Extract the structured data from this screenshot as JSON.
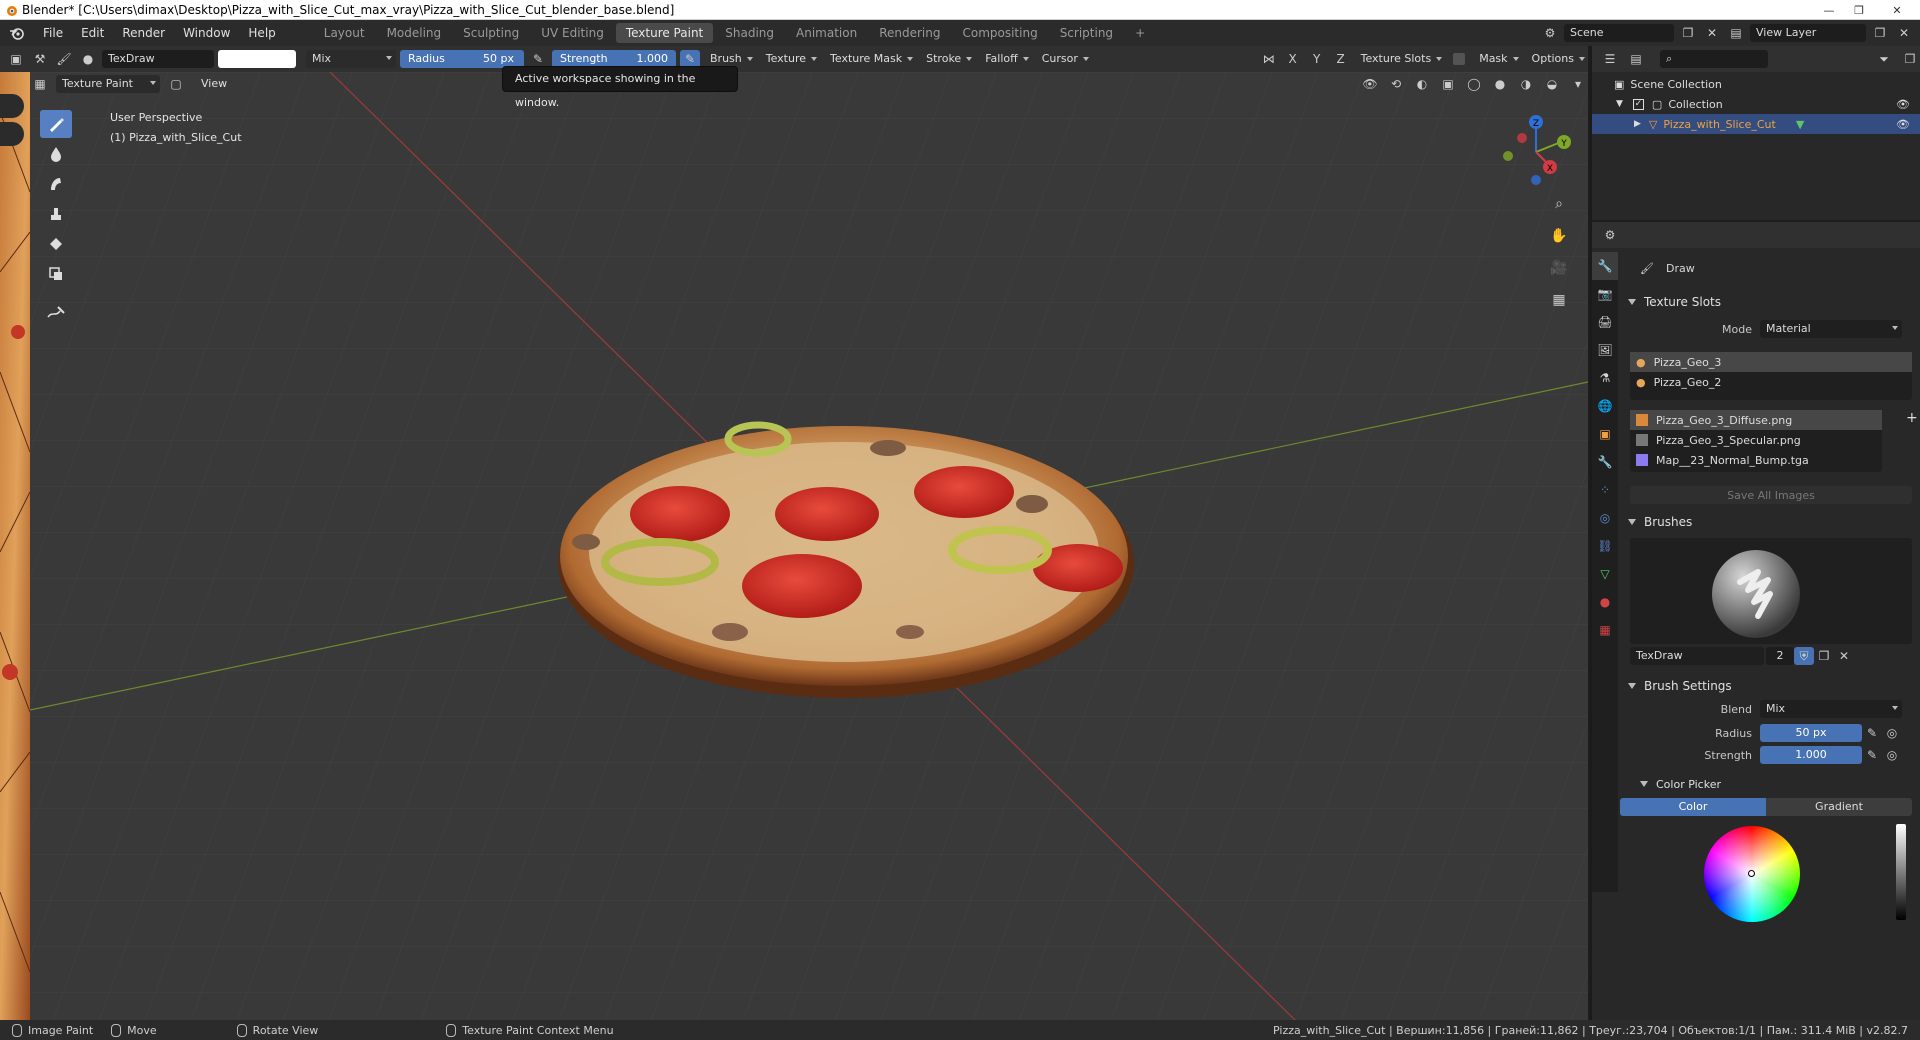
{
  "window": {
    "title": "Blender* [C:\\Users\\dimax\\Desktop\\Pizza_with_Slice_Cut_max_vray\\Pizza_with_Slice_Cut_blender_base.blend]",
    "minimize": "—",
    "maximize": "❐",
    "close": "✕"
  },
  "menubar": {
    "items": [
      "File",
      "Edit",
      "Render",
      "Window",
      "Help"
    ],
    "workspaces": [
      "Layout",
      "Modeling",
      "Sculpting",
      "UV Editing",
      "Texture Paint",
      "Shading",
      "Animation",
      "Rendering",
      "Compositing",
      "Scripting"
    ],
    "active_workspace": "Texture Paint",
    "add_tab": "+",
    "scene": "Scene",
    "view_layer": "View Layer"
  },
  "toolheader": {
    "brush_name": "TexDraw",
    "blend": "Mix",
    "radius_label": "Radius",
    "radius_value": "50 px",
    "strength_label": "Strength",
    "strength_value": "1.000",
    "menus": [
      "Brush",
      "Texture",
      "Texture Mask",
      "Stroke",
      "Falloff",
      "Cursor"
    ],
    "axes": [
      "X",
      "Y",
      "Z"
    ],
    "texture_slots": "Texture Slots",
    "mask": "Mask",
    "options": "Options"
  },
  "vpheader": {
    "mode": "Texture Paint",
    "view": "View"
  },
  "viewport": {
    "perspective": "User Perspective",
    "object": "(1) Pizza_with_Slice_Cut",
    "gizmo": {
      "x": "X",
      "y": "Y",
      "z": "Z"
    }
  },
  "tooltip": {
    "text": "Active workspace showing in the window."
  },
  "outliner": {
    "scene_collection": "Scene Collection",
    "collection": "Collection",
    "object": "Pizza_with_Slice_Cut"
  },
  "properties": {
    "tool_name": "Draw",
    "texture_slots": {
      "header": "Texture Slots",
      "mode_label": "Mode",
      "mode_value": "Material",
      "materials": [
        "Pizza_Geo_3",
        "Pizza_Geo_2"
      ],
      "images": [
        "Pizza_Geo_3_Diffuse.png",
        "Pizza_Geo_3_Specular.png",
        "Map__23_Normal_Bump.tga"
      ],
      "save_all": "Save All Images"
    },
    "brushes": {
      "header": "Brushes",
      "name": "TexDraw",
      "users": "2"
    },
    "brush_settings": {
      "header": "Brush Settings",
      "blend_label": "Blend",
      "blend_value": "Mix",
      "radius_label": "Radius",
      "radius_value": "50 px",
      "strength_label": "Strength",
      "strength_value": "1.000"
    },
    "color_picker": {
      "header": "Color Picker",
      "tab_color": "Color",
      "tab_gradient": "Gradient"
    }
  },
  "statusbar": {
    "image_paint": "Image Paint",
    "move": "Move",
    "rotate": "Rotate View",
    "context_menu": "Texture Paint Context Menu",
    "stats": "Pizza_with_Slice_Cut | Вершин:11,856 | Граней:11,862 | Треуг.:23,704 | Объектов:1/1 | Пам.: 311.4 MiB | v2.82.7"
  },
  "colors": {
    "accent": "#4772b3",
    "selected_row": "#334d80",
    "tool_active": "#5680c2"
  }
}
